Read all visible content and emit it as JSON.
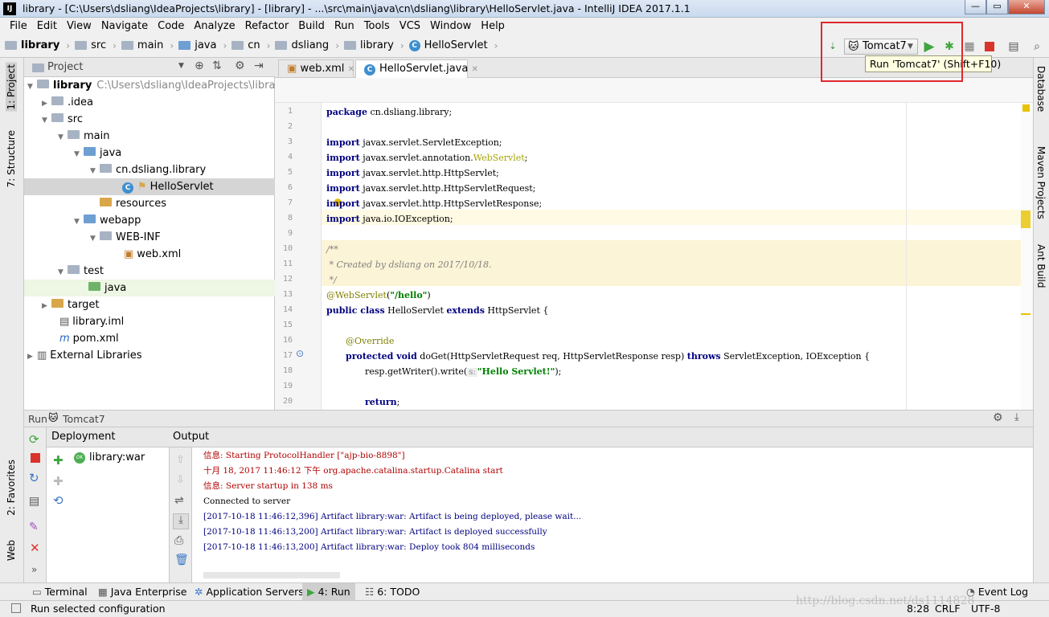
{
  "window": {
    "title": "library - [C:\\Users\\dsliang\\IdeaProjects\\library] - [library] - ...\\src\\main\\java\\cn\\dsliang\\library\\HelloServlet.java - IntelliJ IDEA 2017.1.1",
    "app_icon": "IJ",
    "minimize": "—",
    "maximize": "▭",
    "close": "✕"
  },
  "menu": [
    "File",
    "Edit",
    "View",
    "Navigate",
    "Code",
    "Analyze",
    "Refactor",
    "Build",
    "Run",
    "Tools",
    "VCS",
    "Window",
    "Help"
  ],
  "breadcrumb": [
    "library",
    "src",
    "main",
    "java",
    "cn",
    "dsliang",
    "library",
    "HelloServlet"
  ],
  "toolbar": {
    "run_config": "Tomcat7",
    "tooltip": "Run 'Tomcat7' (Shift+F10)"
  },
  "left_strip": {
    "project_tab": "1: Project",
    "structure_tab": "7: Structure",
    "favorites_tab": "2: Favorites",
    "web_tab": "Web"
  },
  "right_strip": {
    "database": "Database",
    "maven": "Maven Projects",
    "ant": "Ant Build"
  },
  "project": {
    "header": "Project",
    "tree": [
      {
        "label": "library",
        "extra": "C:\\Users\\dsliang\\IdeaProjects\\library",
        "bold": true
      },
      {
        "label": ".idea"
      },
      {
        "label": "src"
      },
      {
        "label": "main"
      },
      {
        "label": "java"
      },
      {
        "label": "cn.dsliang.library"
      },
      {
        "label": "HelloServlet"
      },
      {
        "label": "resources"
      },
      {
        "label": "webapp"
      },
      {
        "label": "WEB-INF"
      },
      {
        "label": "web.xml"
      },
      {
        "label": "test"
      },
      {
        "label": "java"
      },
      {
        "label": "target"
      },
      {
        "label": "library.iml"
      },
      {
        "label": "pom.xml"
      },
      {
        "label": "External Libraries"
      }
    ]
  },
  "editor": {
    "tabs": [
      "web.xml",
      "HelloServlet.java"
    ],
    "line_numbers": [
      "1",
      "2",
      "3",
      "4",
      "5",
      "6",
      "7",
      "8",
      "9",
      "10",
      "11",
      "12",
      "13",
      "14",
      "15",
      "16",
      "17",
      "18",
      "19",
      "20"
    ],
    "lines": {
      "l1_kw": "package",
      "l1_rest": " cn.dsliang.library;",
      "l3_kw": "import",
      "l3_rest": " javax.servlet.ServletException;",
      "l4_kw": "import",
      "l4_rest": " javax.servlet.annotation.",
      "l4_ann": "WebServlet",
      "l4_end": ";",
      "l5_kw": "import",
      "l5_rest": " javax.servlet.http.HttpServlet;",
      "l6_kw": "import",
      "l6_rest": " javax.servlet.http.HttpServletRequest;",
      "l7_kw": "import",
      "l7_rest": " javax.servlet.http.HttpServletResponse;",
      "l8_kw": "import",
      "l8_rest": " java.io.IOException;",
      "l10": "/**",
      "l11": " * Created by dsliang on 2017/10/18.",
      "l12": " */",
      "l13_ann": "@WebServlet",
      "l13_p1": "(",
      "l13_str": "\"/hello\"",
      "l13_p2": ")",
      "l14_kw1": "public class",
      "l14_name": " HelloServlet ",
      "l14_kw2": "extends",
      "l14_rest": " HttpServlet {",
      "l16": "@Override",
      "l17_kw": "protected void",
      "l17_rest": " doGet(HttpServletRequest req, HttpServletResponse resp) ",
      "l17_kw2": "throws",
      "l17_end": " ServletException, IOException {",
      "l18_a": "resp.getWriter().write(",
      "l18_hint": "s:",
      "l18_str": "\"Hello Servlet!\"",
      "l18_b": ");",
      "l20_kw": "return",
      "l20_end": ";"
    }
  },
  "run": {
    "header_label": "Run",
    "config": "Tomcat7",
    "deployment_header": "Deployment",
    "output_header": "Output",
    "artifact": "library:war",
    "output": [
      {
        "text": "信息: Starting ProtocolHandler [\"ajp-bio-8898\"]",
        "color": "red"
      },
      {
        "text": "十月 18, 2017 11:46:12 下午 org.apache.catalina.startup.Catalina start",
        "color": "red"
      },
      {
        "text": "信息: Server startup in 138 ms",
        "color": "red"
      },
      {
        "text": "Connected to server",
        "color": "black"
      },
      {
        "text": "[2017-10-18 11:46:12,396] Artifact library:war: Artifact is being deployed, please wait...",
        "color": "navy"
      },
      {
        "text": "[2017-10-18 11:46:13,200] Artifact library:war: Artifact is deployed successfully",
        "color": "navy"
      },
      {
        "text": "[2017-10-18 11:46:13,200] Artifact library:war: Deploy took 804 milliseconds",
        "color": "navy"
      }
    ]
  },
  "bottom_tabs": [
    "Terminal",
    "Java Enterprise",
    "Application Servers",
    "4: Run",
    "6: TODO"
  ],
  "event_log": "Event Log",
  "status": {
    "message": "Run selected configuration",
    "position": "8:28",
    "line_sep": "CRLF",
    "encoding": "UTF-8"
  },
  "watermark": "http://blog.csdn.net/ds1114828",
  "colors": {
    "highlight_box": "#e0282e",
    "run_green": "#3fa63f",
    "stop_red": "#d9342b"
  }
}
